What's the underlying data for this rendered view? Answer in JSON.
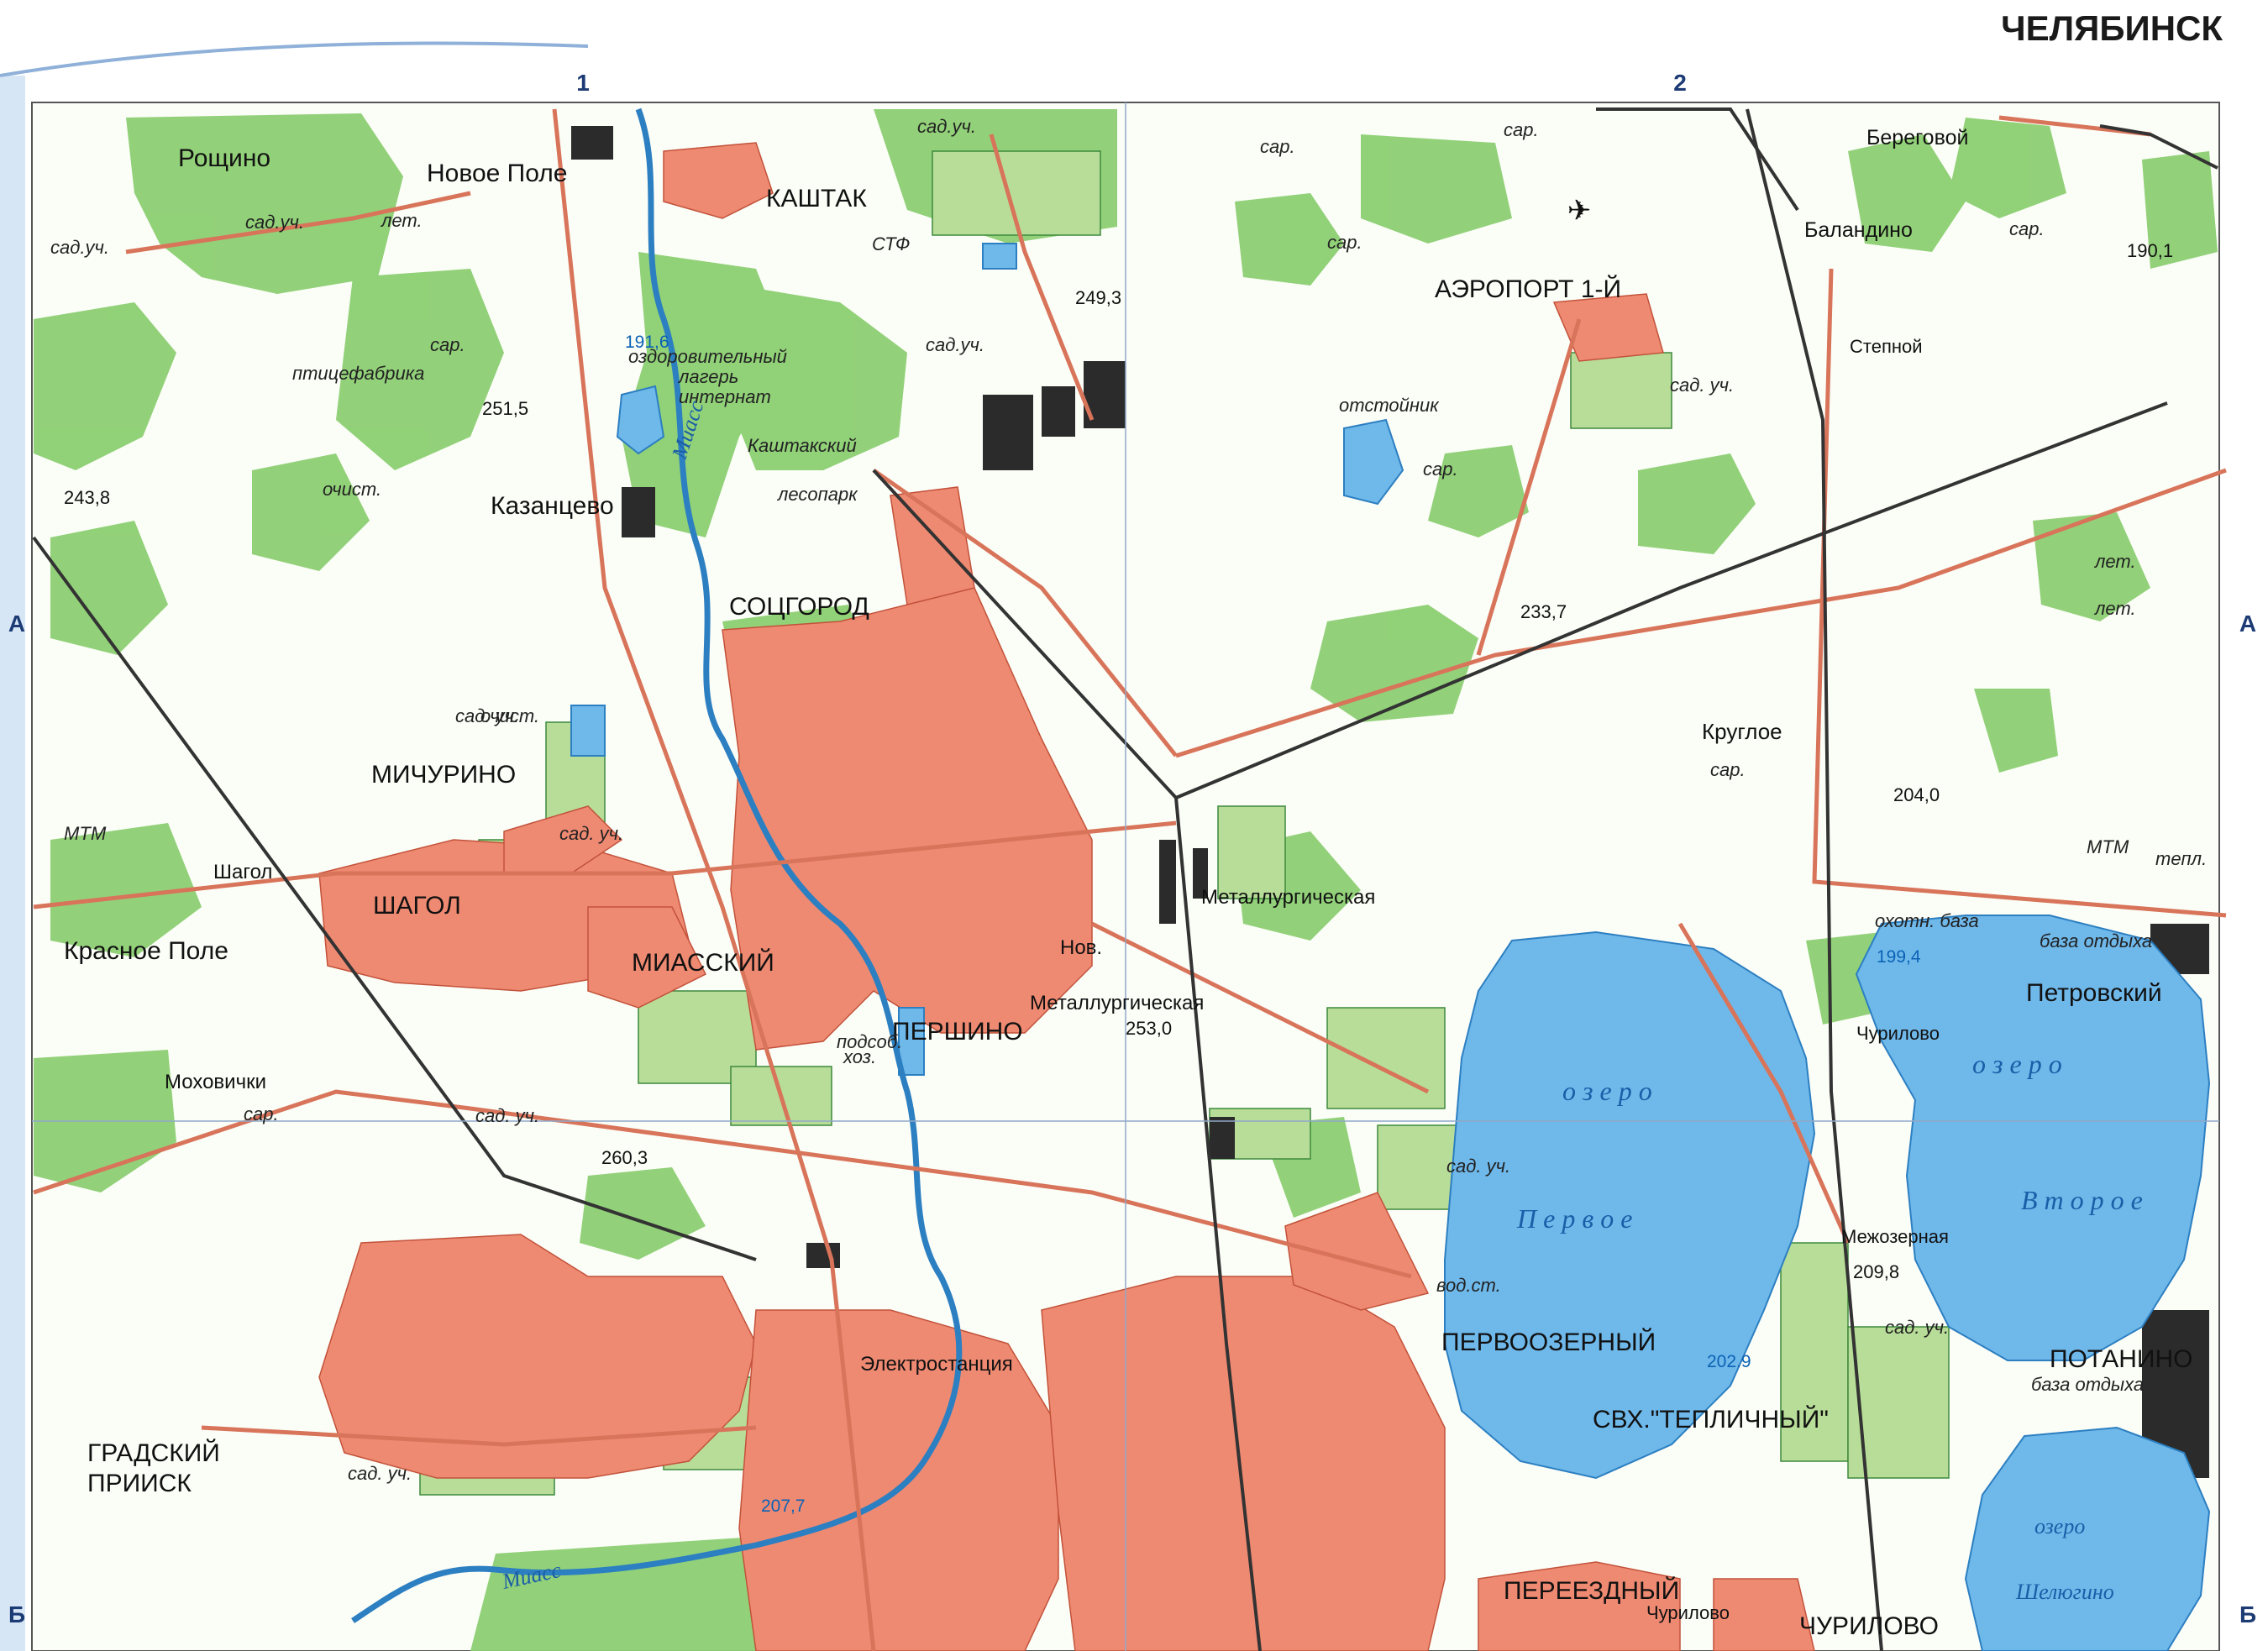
{
  "title": "ЧЕЛЯБИНСК",
  "grid": {
    "columns": [
      "1",
      "2"
    ],
    "rows": [
      "А",
      "Б"
    ]
  },
  "colors": {
    "urban": "#ef8a72",
    "forest": "#8ccf72",
    "garden": "#cfe8b5",
    "water": "#6fb8ea",
    "road": "#d8745a",
    "railway": "#333333",
    "frame": "#8fb0d8"
  },
  "labels": {
    "roshchino": "Рощино",
    "novoe_pole": "Новое Поле",
    "kashtak": "КАШТАК",
    "stf": "СТФ",
    "sad_uch": "сад.уч.",
    "sad_uch2": "сад. уч.",
    "let": "лет.",
    "sar": "сар.",
    "ptitsefabrika": "птицефабрика",
    "ochist": "очист.",
    "kazantsevo": "Казанцево",
    "ozdorov_1": "оздоровительный",
    "ozdorov_2": "лагерь",
    "ozdorov_3": "интернат",
    "kashtaksky": "Каштакский",
    "lesopark": "лесопарк",
    "sotsgorod": "СОЦГОРОД",
    "aeroport": "АЭРОПОРТ 1-Й",
    "otstoinik": "отстойник",
    "beregovoy": "Береговой",
    "balandino": "Баландино",
    "stepnoy": "Степной",
    "miass_river": "Миасс",
    "michurino": "МИЧУРИНО",
    "mtm": "МТМ",
    "shagol_st": "Шагол",
    "shagol": "ШАГОЛ",
    "krasnoe_pole": "Красное Поле",
    "miassky": "МИАССКИЙ",
    "mokhovichki": "Моховички",
    "metallurgicheskaya": "Металлургическая",
    "nov": "Нов.",
    "nov_metall": "Металлургическая",
    "pershino": "ПЕРШИНО",
    "podsob": "подсоб.",
    "khoz": "хоз.",
    "krugloe": "Круглое",
    "tepl": "тепл.",
    "okhotn_baza": "охотн. база",
    "baza_otdykha": "база отдыха",
    "petrovsky": "Петровский",
    "churilovo": "Чурилово",
    "churilovo_caps": "ЧУРИЛОВО",
    "ozero": "о з е р о",
    "pervoe": "П е р в о е",
    "vtoroe": "В т о р о е",
    "mezhozernaya": "Межозерная",
    "vod_st": "вод.ст.",
    "pervoozerny": "ПЕРВООЗЕРНЫЙ",
    "svkh": "СВХ.\"ТЕПЛИЧНЫЙ\"",
    "potanino": "ПОТАНИНО",
    "shelyugino": "Шелюгино",
    "ozero_small": "озеро",
    "elektrostantsiya": "Электростанция",
    "gradsky_1": "ГРАДСКИЙ",
    "gradsky_2": "ПРИИСК",
    "pereezdny": "ПЕРЕЕЗДНЫЙ",
    "churilovo_small": "Чурилово"
  },
  "elevations": {
    "e191_6": "191,6",
    "e249_3": "249,3",
    "e251_5": "251,5",
    "e243_8": "243,8",
    "e190_1": "190,1",
    "e233_7": "233,7",
    "e204_0": "204,0",
    "e199_4": "199,4",
    "e253_0": "253,0",
    "e260_3": "260,3",
    "e209_8": "209,8",
    "e202_9": "202.9",
    "e207_7": "207,7"
  }
}
